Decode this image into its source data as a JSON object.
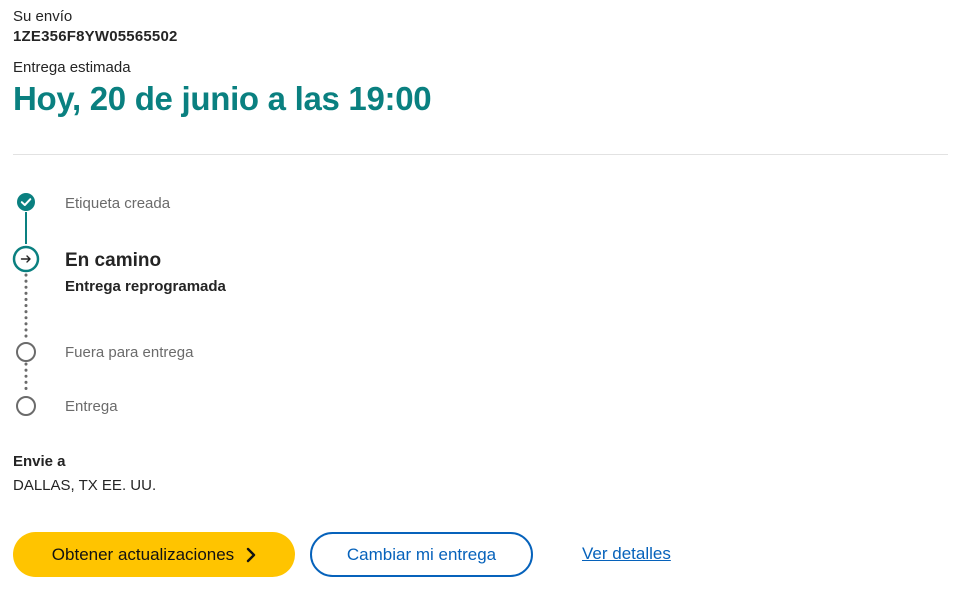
{
  "shipment": {
    "label": "Su envío",
    "tracking_number": "1ZE356F8YW05565502",
    "eta_label": "Entrega estimada",
    "eta_value": "Hoy, 20 de junio a las 19:00"
  },
  "progress": {
    "steps": [
      {
        "label": "Etiqueta creada",
        "state": "done"
      },
      {
        "label": "En camino",
        "sublabel": "Entrega reprogramada",
        "state": "current"
      },
      {
        "label": "Fuera para entrega",
        "state": "pending"
      },
      {
        "label": "Entrega",
        "state": "pending"
      }
    ]
  },
  "destination": {
    "label": "Envie a",
    "value": "DALLAS, TX EE. UU."
  },
  "actions": {
    "updates_button": "Obtener actualizaciones",
    "change_button": "Cambiar mi entrega",
    "details_link": "Ver detalles"
  },
  "colors": {
    "accent_teal": "#0a8080",
    "primary_button": "#ffc400",
    "link_blue": "#0662bb"
  }
}
